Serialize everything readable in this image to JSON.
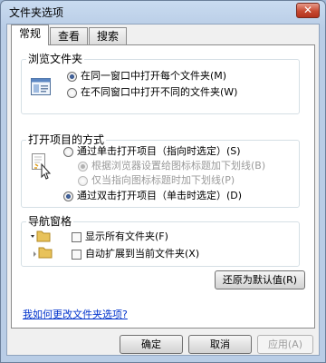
{
  "window": {
    "title": "文件夹选项",
    "close_glyph": "✕"
  },
  "tabs": [
    {
      "label": "常规",
      "active": true
    },
    {
      "label": "查看",
      "active": false
    },
    {
      "label": "搜索",
      "active": false
    }
  ],
  "browse": {
    "title": "浏览文件夹",
    "options": [
      "在同一窗口中打开每个文件夹(M)",
      "在不同窗口中打开不同的文件夹(W)"
    ],
    "selected": 0
  },
  "click": {
    "title": "打开项目的方式",
    "options": [
      "通过单击打开项目（指向时选定）(S)",
      "根据浏览器设置给图标标题加下划线(B)",
      "仅当指向图标标题时加下划线(P)",
      "通过双击打开项目（单击时选定）(D)"
    ],
    "selected": 3
  },
  "nav": {
    "title": "导航窗格",
    "options": [
      "显示所有文件夹(F)",
      "自动扩展到当前文件夹(X)"
    ]
  },
  "restore_label": "还原为默认值(R)",
  "help_link": "我如何更改文件夹选项?",
  "buttons": {
    "ok": "确定",
    "cancel": "取消",
    "apply": "应用(A)"
  },
  "colors": {
    "link": "#0033cc",
    "close_button": "#c74a32",
    "title_bar": "#b9cde6"
  },
  "icons": [
    "window-icon",
    "pointer-icon",
    "folder-tree-icon"
  ]
}
